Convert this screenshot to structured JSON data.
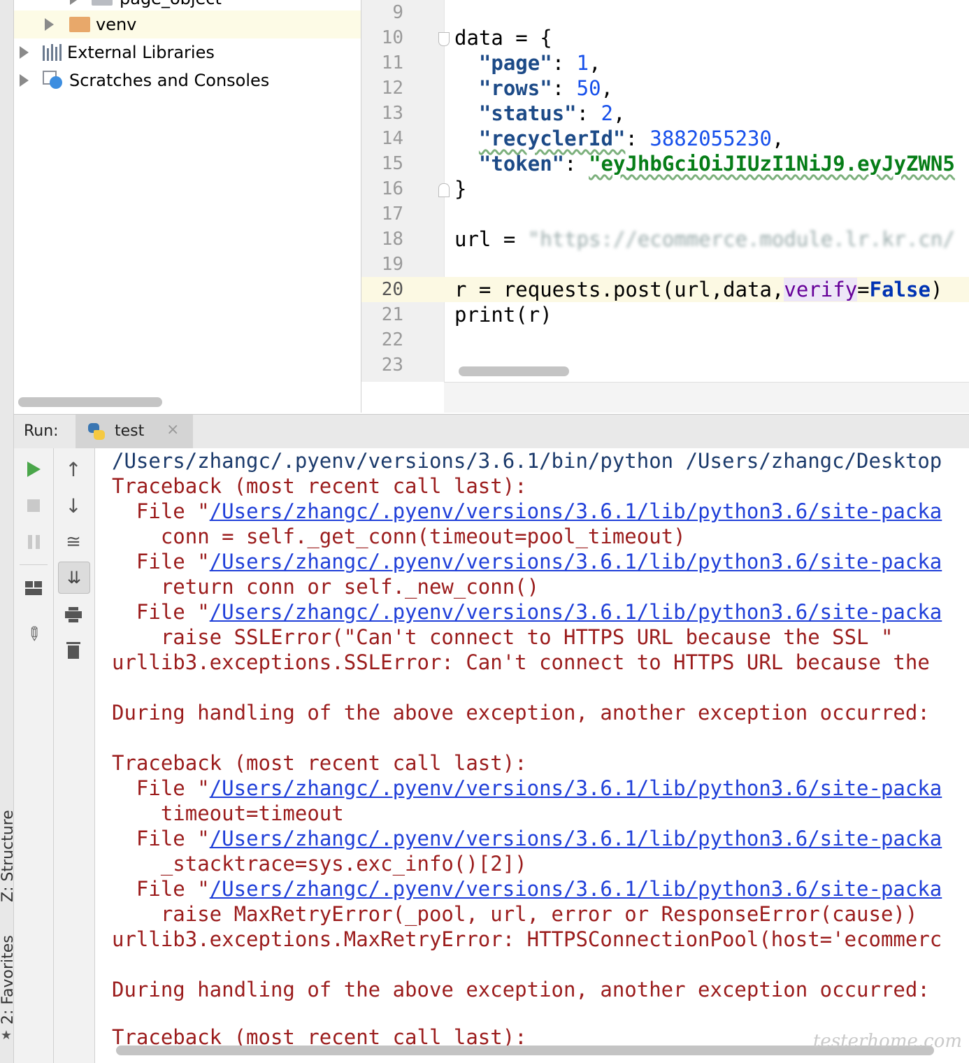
{
  "sidebar": {
    "structure_label": "Z: Structure",
    "favorites_label": "2: Favorites"
  },
  "project": {
    "partial_item": "page_object",
    "items": [
      {
        "label": "venv"
      },
      {
        "label": "External Libraries"
      },
      {
        "label": "Scratches and Consoles"
      }
    ]
  },
  "editor": {
    "line_numbers": [
      "9",
      "10",
      "11",
      "12",
      "13",
      "14",
      "15",
      "16",
      "17",
      "18",
      "19",
      "20",
      "21",
      "22",
      "23"
    ],
    "code": {
      "l10_a": "data = {",
      "l11_key": "\"page\"",
      "l11_sep": ": ",
      "l11_val": "1",
      "l11_end": ",",
      "l12_key": "\"rows\"",
      "l12_sep": ": ",
      "l12_val": "50",
      "l12_end": ",",
      "l13_key": "\"status\"",
      "l13_sep": ": ",
      "l13_val": "2",
      "l13_end": ",",
      "l14_key": "\"recyclerId\"",
      "l14_sep": ": ",
      "l14_val": "3882055230",
      "l14_end": ",",
      "l15_key": "\"token\"",
      "l15_sep": ": ",
      "l15_val": "\"eyJhbGciOiJIUzI1NiJ9.eyJyZWN5",
      "l16": "}",
      "l18_a": "url = ",
      "l18_blur": "\"https://ecommerce.module.lr.kr.cn/",
      "l20_a": "r = requests.post(url,data,",
      "l20_param": "verify",
      "l20_eq": "=",
      "l20_kw": "False",
      "l20_end": ")",
      "l21": "print(r)"
    }
  },
  "run": {
    "label": "Run:",
    "tab_label": "test"
  },
  "console": {
    "line1": "/Users/zhangc/.pyenv/versions/3.6.1/bin/python /Users/zhangc/Desktop",
    "tb1": "Traceback (most recent call last):",
    "file_prefix": "  File \"",
    "link": "/Users/zhangc/.pyenv/versions/3.6.1/lib/python3.6/site-packa",
    "c1": "    conn = self._get_conn(timeout=pool_timeout)",
    "c2": "    return conn or self._new_conn()",
    "c3": "    raise SSLError(\"Can't connect to HTTPS URL because the SSL \"",
    "c4": "urllib3.exceptions.SSLError: Can't connect to HTTPS URL because the ",
    "during": "During handling of the above exception, another exception occurred:",
    "tb2": "Traceback (most recent call last):",
    "c5": "    timeout=timeout",
    "c6": "    _stacktrace=sys.exc_info()[2])",
    "c7": "    raise MaxRetryError(_pool, url, error or ResponseError(cause))",
    "c8": "urllib3.exceptions.MaxRetryError: HTTPSConnectionPool(host='ecommerc",
    "during2": "During handling of the above exception, another exception occurred:",
    "tb3": "Traceback (most recent call last):"
  },
  "watermark": "testerhome.com"
}
